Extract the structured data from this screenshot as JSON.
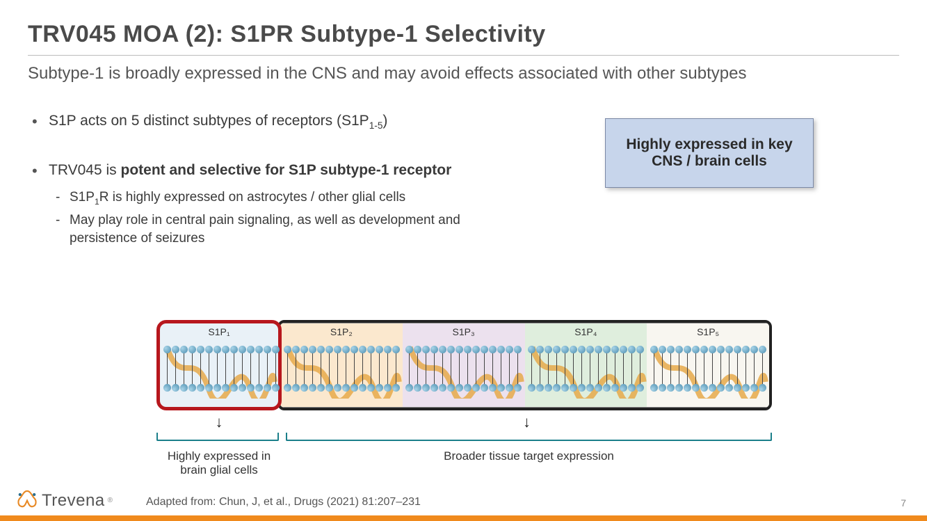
{
  "title": "TRV045 MOA (2): S1PR Subtype-1 Selectivity",
  "subtitle": "Subtype-1 is broadly expressed in the CNS and may avoid effects associated with other subtypes",
  "bullets": {
    "b1_pre": "S1P acts on 5 distinct subtypes of receptors (S1P",
    "b1_sub": "1-5",
    "b1_post": ")",
    "b2_pre": "TRV045 is ",
    "b2_bold": "potent and selective for S1P subtype-1 receptor",
    "s1_pre": "S1P",
    "s1_sub": "1",
    "s1_post": "R is highly expressed on astrocytes / other glial cells",
    "s2": "May play role in central pain signaling, as well as development and persistence of seizures"
  },
  "callout": "Highly expressed in key CNS / brain cells",
  "panels": {
    "p1": "S1P₁",
    "p2": "S1P₂",
    "p3": "S1P₃",
    "p4": "S1P₄",
    "p5": "S1P₅"
  },
  "captions": {
    "c1": "Highly expressed in brain glial cells",
    "c2": "Broader tissue target expression"
  },
  "arrow": "↓",
  "citation": "Adapted from:  Chun, J, et al., Drugs (2021) 81:207–231",
  "page": "7",
  "logo": "Trevena",
  "logo_r": "®"
}
